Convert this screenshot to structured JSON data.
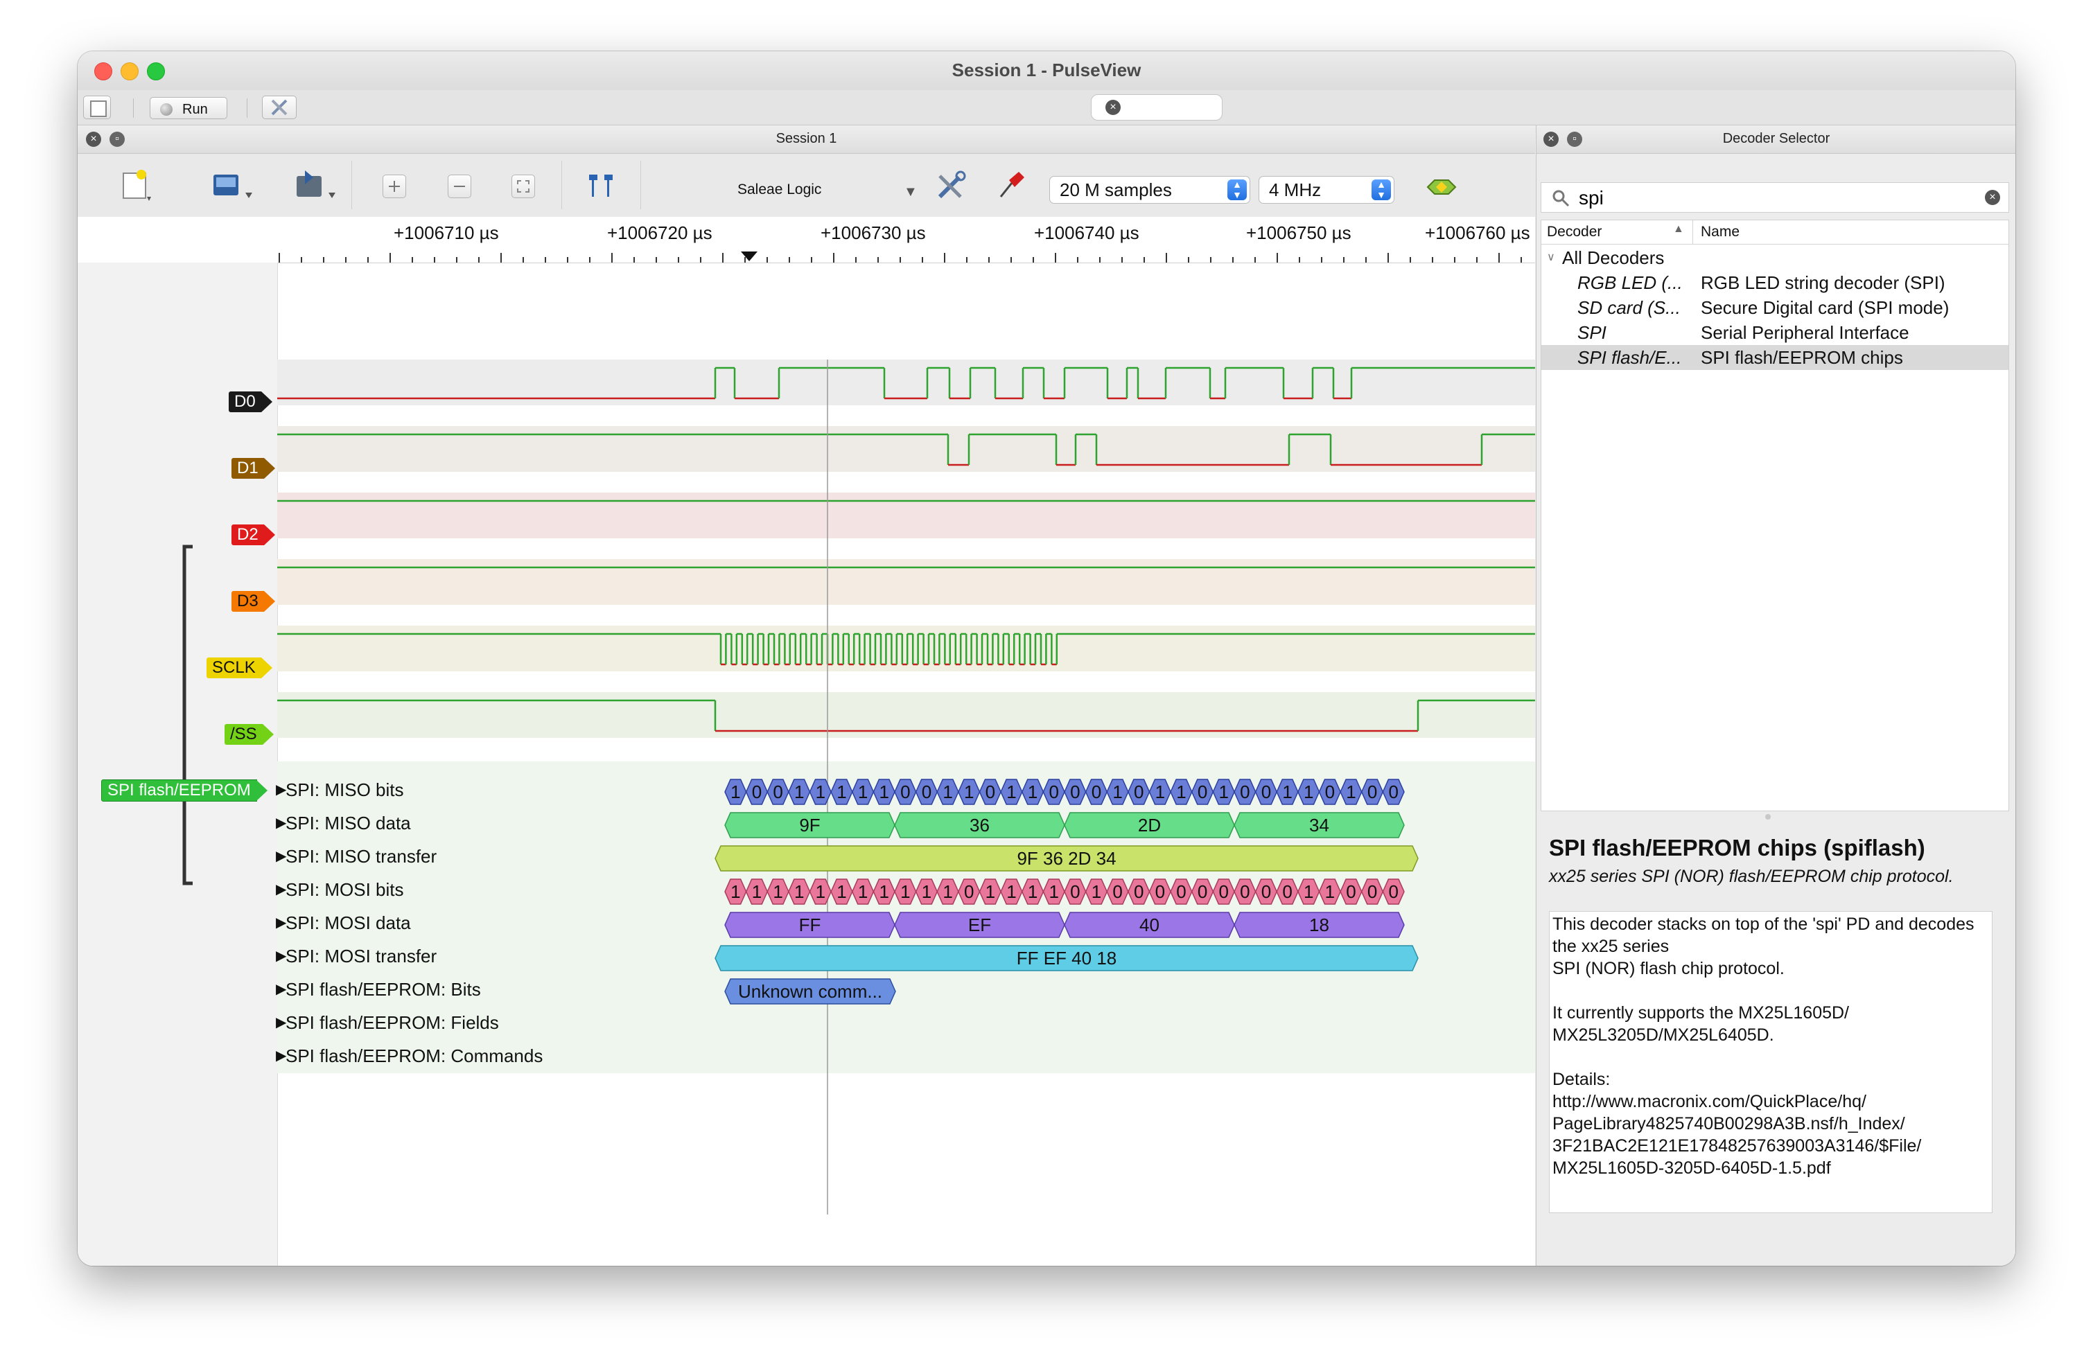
{
  "window": {
    "title": "Session 1 - PulseView"
  },
  "top_toolbar": {
    "run_label": "Run"
  },
  "session": {
    "title": "Session 1",
    "device": "Saleae Logic",
    "samples": "20 M samples",
    "samplerate": "4 MHz"
  },
  "ruler": {
    "ticks": [
      "+1006710 µs",
      "+1006720 µs",
      "+1006730 µs",
      "+1006740 µs",
      "+1006750 µs",
      "+1006760 µs"
    ]
  },
  "channels": [
    {
      "name": "D0",
      "color": "#1a1a1a"
    },
    {
      "name": "D1",
      "color": "#8f5a00"
    },
    {
      "name": "D2",
      "color": "#e01b1b"
    },
    {
      "name": "D3",
      "color": "#f57900"
    },
    {
      "name": "SCLK",
      "color": "#edd400"
    },
    {
      "name": "/SS",
      "color": "#73d216"
    }
  ],
  "decoder_label": "SPI flash/EEPROM",
  "decoder_rows": [
    "SPI: MISO bits",
    "SPI: MISO data",
    "SPI: MISO transfer",
    "SPI: MOSI bits",
    "SPI: MOSI data",
    "SPI: MOSI transfer",
    "SPI flash/EEPROM: Bits",
    "SPI flash/EEPROM: Fields",
    "SPI flash/EEPROM: Commands"
  ],
  "annotations": {
    "miso_bits": [
      "1",
      "0",
      "0",
      "1",
      "1",
      "1",
      "1",
      "1",
      "0",
      "0",
      "1",
      "1",
      "0",
      "1",
      "1",
      "0",
      "0",
      "0",
      "1",
      "0",
      "1",
      "1",
      "0",
      "1",
      "0",
      "0",
      "1",
      "1",
      "0",
      "1",
      "0",
      "0"
    ],
    "miso_data": [
      "9F",
      "36",
      "2D",
      "34"
    ],
    "miso_transfer": "9F 36 2D 34",
    "mosi_bits": [
      "1",
      "1",
      "1",
      "1",
      "1",
      "1",
      "1",
      "1",
      "1",
      "1",
      "1",
      "0",
      "1",
      "1",
      "1",
      "1",
      "0",
      "1",
      "0",
      "0",
      "0",
      "0",
      "0",
      "0",
      "0",
      "0",
      "0",
      "1",
      "1",
      "0",
      "0",
      "0"
    ],
    "mosi_data": [
      "FF",
      "EF",
      "40",
      "18"
    ],
    "mosi_transfer": "FF EF 40 18",
    "flash_bits": "Unknown comm..."
  },
  "decoder_selector": {
    "title": "Decoder Selector",
    "search_value": "spi",
    "col_decoder": "Decoder",
    "col_name": "Name",
    "root": "All Decoders",
    "items": [
      {
        "decoder": "RGB LED (...",
        "name": "RGB LED string decoder (SPI)"
      },
      {
        "decoder": "SD card (S...",
        "name": "Secure Digital card (SPI mode)"
      },
      {
        "decoder": "SPI",
        "name": "Serial Peripheral Interface"
      },
      {
        "decoder": "SPI flash/E...",
        "name": "SPI flash/EEPROM chips"
      }
    ],
    "selected_index": 3,
    "desc_title": "SPI flash/EEPROM chips (spiflash)",
    "desc_subtitle": "xx25 series SPI (NOR) flash/EEPROM chip protocol.",
    "desc_body": "This decoder stacks on top of the 'spi' PD and decodes the xx25 series\nSPI (NOR) flash chip protocol.\n\nIt currently supports the MX25L1605D/\nMX25L3205D/MX25L6405D.\n\nDetails:\nhttp://www.macronix.com/QuickPlace/hq/\nPageLibrary4825740B00298A3B.nsf/h_Index/\n3F21BAC2E121E17848257639003A3146/$File/\nMX25L1605D-3205D-6405D-1.5.pdf"
  }
}
